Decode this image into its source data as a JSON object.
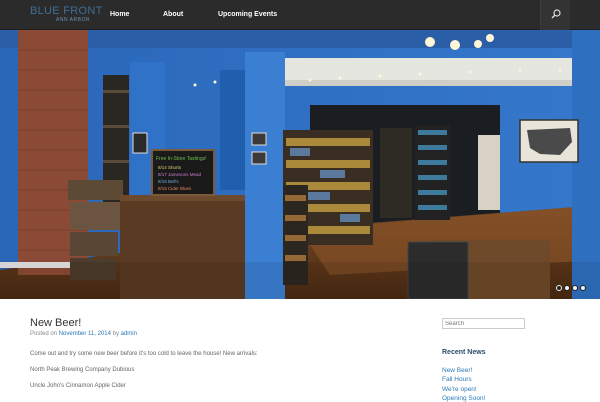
{
  "header": {
    "logo_main": "BLUE FRONT",
    "logo_sub": "ANN ARBOR",
    "nav": [
      {
        "label": "Home"
      },
      {
        "label": "About"
      },
      {
        "label": "Upcoming Events"
      }
    ],
    "search_icon": "search-icon"
  },
  "hero": {
    "chalkboard_lines": [
      "Free In-Store Tastings!",
      "8/14 Shorts",
      "8/17 Jamesons Mead",
      "8/18 Bell's",
      "8/19 Cider Blues"
    ],
    "slide_count": 4,
    "active_slide": 1
  },
  "post": {
    "title": "New Beer!",
    "posted_on_prefix": "Posted on ",
    "date": "November 11, 2014",
    "by": " by ",
    "author": "admin",
    "intro": "Come out and try some new beer before it's too cold to leave the house! New arrivals:",
    "items": [
      "North Peak Brewing Company Dubious",
      "Uncle John's Cinnamon Apple Cider"
    ]
  },
  "sidebar": {
    "search_placeholder": "Search",
    "recent_news_heading": "Recent News",
    "recent_news": [
      "New Beer!",
      "Fall Hours",
      "We're open!",
      "Opening Soon!"
    ]
  },
  "colors": {
    "topbar": "#2b2b2b",
    "wall_blue": "#2f6fc4",
    "link": "#2a7ab8"
  }
}
